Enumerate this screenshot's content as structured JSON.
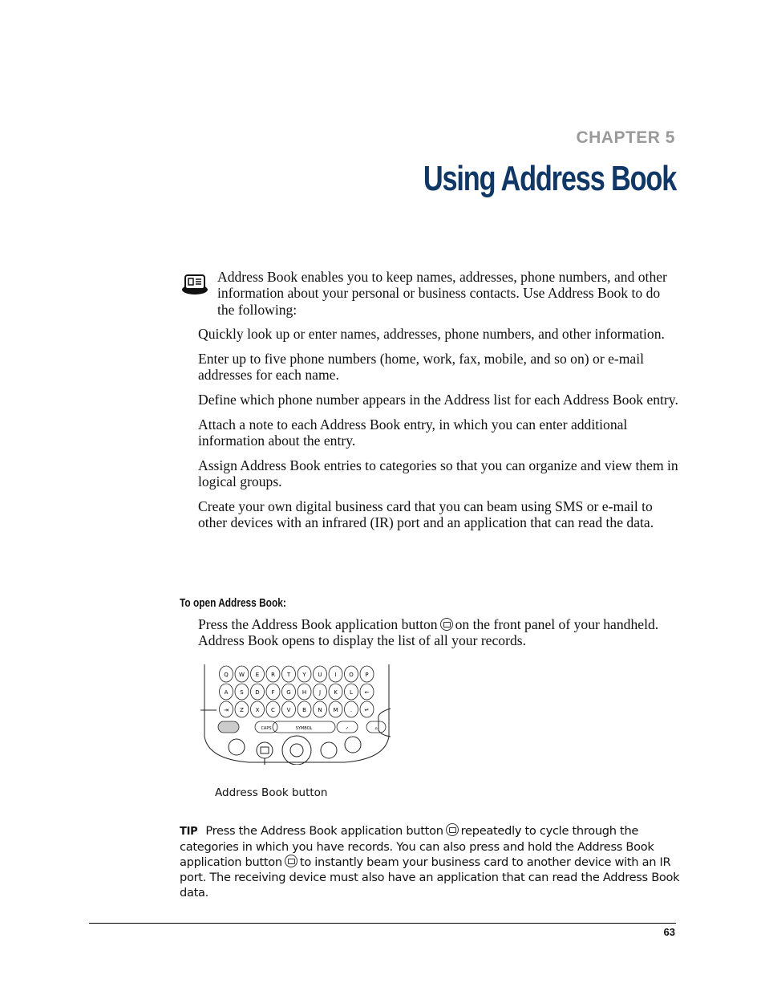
{
  "header": {
    "chapter_label": "CHAPTER 5",
    "chapter_title": "Using Address Book",
    "title_color": "#0f3868",
    "label_color": "#9a9a9a"
  },
  "intro": {
    "icon": "address-book-card-icon",
    "text": "Address Book enables you to keep names, addresses, phone numbers, and other information about your personal or business contacts. Use Address Book to do the following:"
  },
  "features": [
    "Quickly look up or enter names, addresses, phone numbers, and other information.",
    "Enter up to five phone numbers (home, work, fax, mobile, and so on) or e-mail addresses for each name.",
    "Define which phone number appears in the Address list for each Address Book entry.",
    "Attach a note to each Address Book entry, in which you can enter additional information about the entry.",
    "Assign Address Book entries to categories so that you can organize and view them in logical groups.",
    "Create your own digital business card that you can beam using SMS or e-mail to other devices with an infrared (IR) port and an application that can read the data."
  ],
  "procedure": {
    "heading": "To open Address Book:",
    "text_before_icon": "Press the Address Book application button",
    "text_after_icon": "on the front panel of your handheld. Address Book opens to display the list of all your records."
  },
  "figure": {
    "keyboard_rows": [
      [
        "Q",
        "W",
        "E",
        "R",
        "T",
        "Y",
        "U",
        "I",
        "O",
        "P"
      ],
      [
        "A",
        "S",
        "D",
        "F",
        "G",
        "H",
        "J",
        "K",
        "L",
        "←"
      ],
      [
        "⇥",
        "Z",
        "X",
        "C",
        "V",
        "B",
        "N",
        "M",
        ".",
        "↵"
      ]
    ],
    "bottom_row": [
      "",
      "CAPS",
      "SYMBOL",
      "✓",
      "⌂"
    ],
    "callout": "Address Book button"
  },
  "tip": {
    "label": "TIP",
    "part1": "Press the Address Book application button",
    "part2": "repeatedly to cycle through the categories in which you have records. You can also press and hold the Address Book application button",
    "part3": "to instantly beam your business card to another device with an IR port. The receiving device must also have an application that can read the Address Book data."
  },
  "footer": {
    "page_number": "63"
  }
}
